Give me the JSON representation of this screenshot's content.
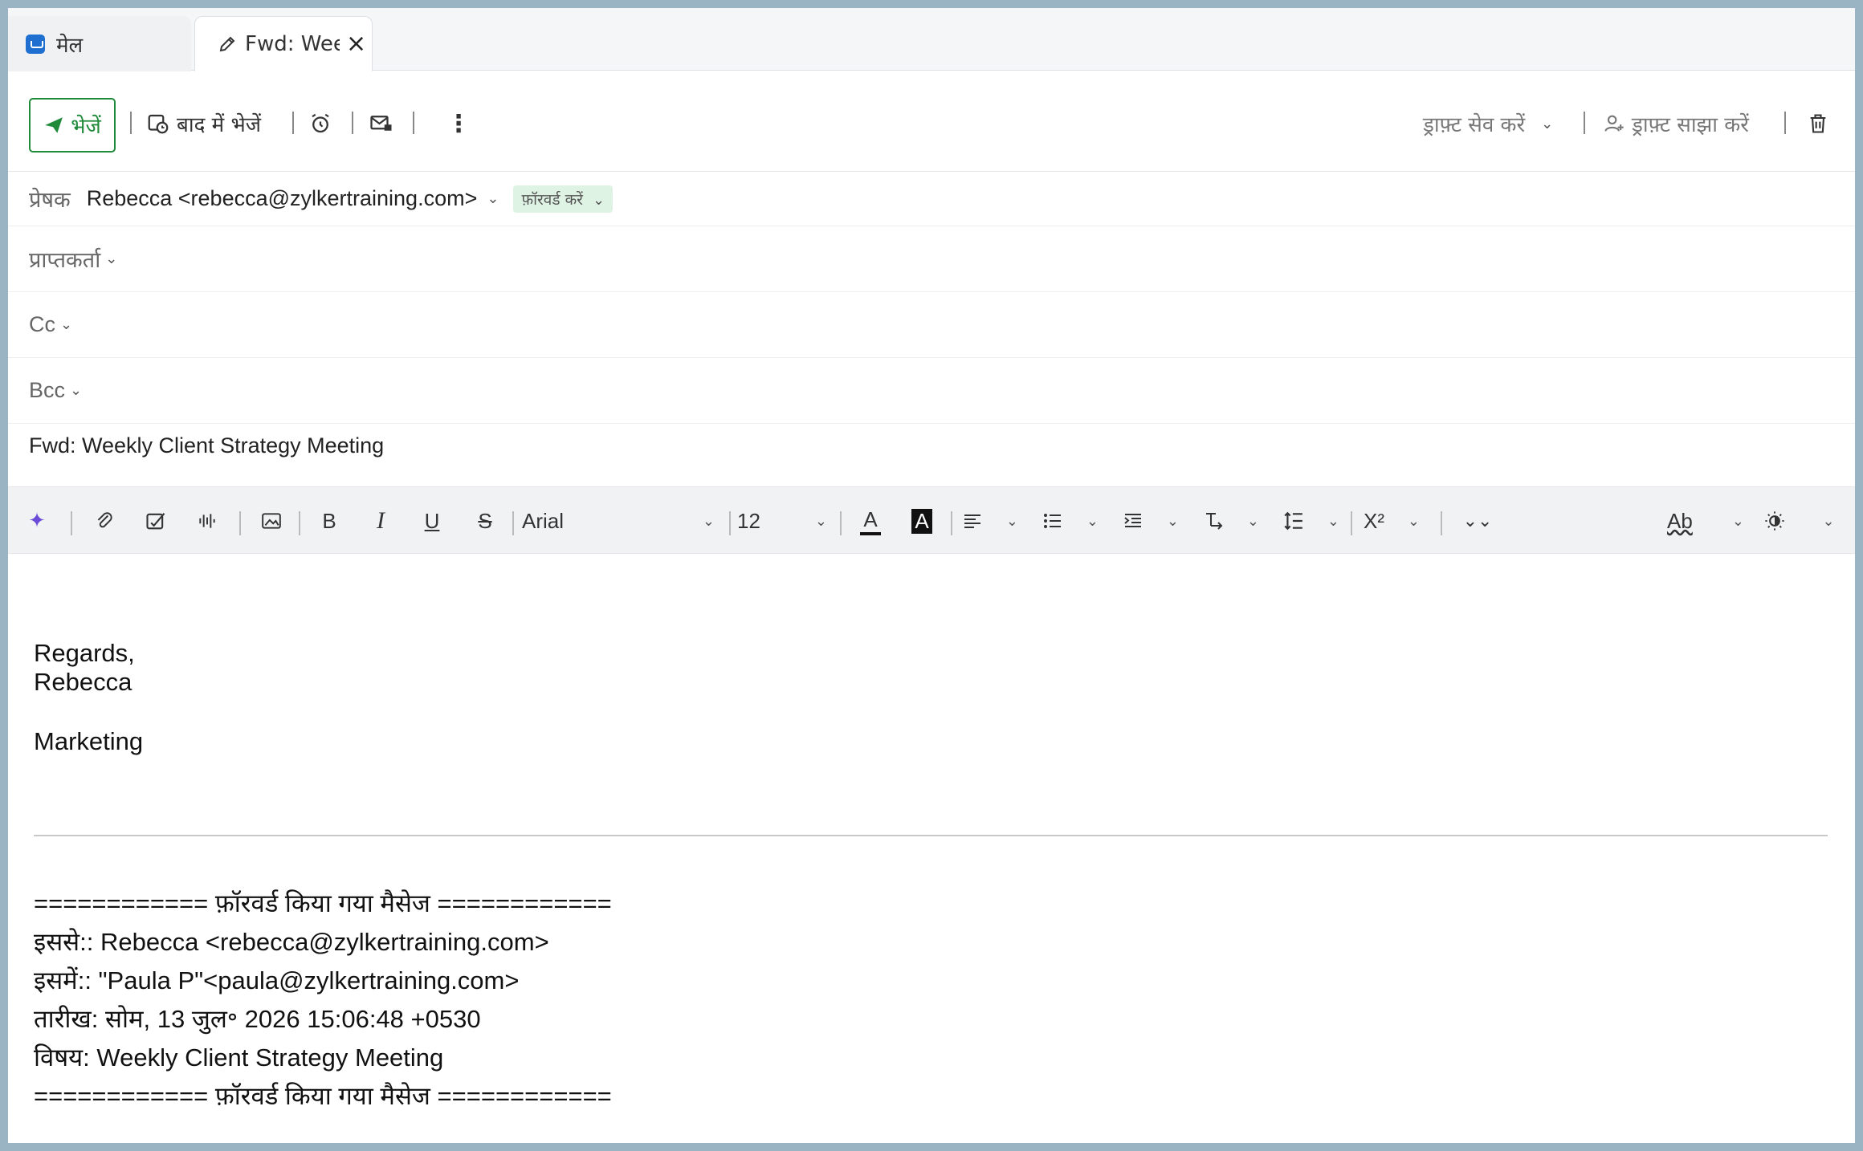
{
  "tabs": [
    {
      "label": "मेल",
      "icon": "mail-icon"
    },
    {
      "label": "Fwd: Wee",
      "icon": "pencil-icon"
    }
  ],
  "toolbar": {
    "send_label": "भेजें",
    "send_later_label": "बाद में भेजें",
    "save_draft_label": "ड्राफ़्ट सेव करें",
    "share_draft_label": "ड्राफ़्ट साझा करें"
  },
  "header": {
    "from_label": "प्रेषक",
    "from_value": "Rebecca <rebecca@zylkertraining.com>",
    "forward_badge": "फ़ॉरवर्ड करें",
    "to_label": "प्राप्तकर्ता",
    "cc_label": "Cc",
    "bcc_label": "Bcc",
    "subject": "Fwd: Weekly Client Strategy Meeting"
  },
  "format_bar": {
    "font": "Arial",
    "size": "12"
  },
  "body": {
    "line1": "Regards,",
    "line2": "Rebecca",
    "line3": "Marketing",
    "fwd_sep1": "============ फ़ॉरवर्ड किया गया मैसेज ============",
    "from_line": "इससे:: Rebecca <rebecca@zylkertraining.com>",
    "to_line": "इसमें:: \"Paula P\"<paula@zylkertraining.com>",
    "date_line": "तारीख: सोम, 13 जुल॰ 2026 15:06:48 +0530",
    "subject_line": "विषय: Weekly Client Strategy Meeting",
    "fwd_sep2": "============ फ़ॉरवर्ड किया गया मैसेज ============"
  }
}
